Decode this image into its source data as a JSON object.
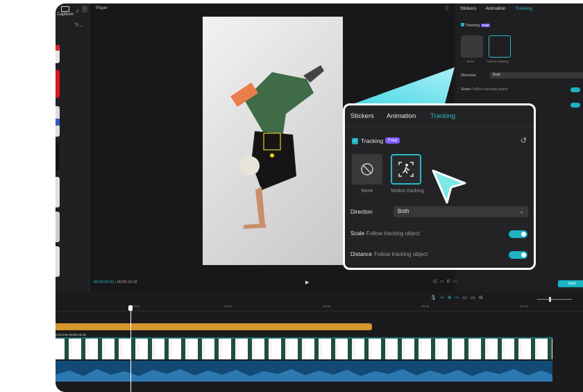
{
  "left_panel": {
    "captions_tab": "Captions",
    "second_tab": "F",
    "text_tool": "Tr"
  },
  "player": {
    "title": "Player",
    "current_time": "00:00:02:03",
    "total_time": "00:00:10:18"
  },
  "right_panel": {
    "tabs": [
      "Stickers",
      "Animation",
      "Tracking"
    ],
    "tracking_label": "Tracking",
    "free_badge": "Free",
    "option_none": "None",
    "option_motion": "Motion tracking",
    "direction_label": "Direction",
    "direction_value": "Both",
    "scale_label": "Scale",
    "scale_sub": "Follow tracking object",
    "start_button": "Start"
  },
  "popup": {
    "tabs": [
      "Stickers",
      "Animation",
      "Tracking"
    ],
    "tracking_label": "Tracking",
    "free_badge": "Free",
    "option_none": "None",
    "option_motion": "Motion tracking",
    "direction_label": "Direction",
    "direction_value": "Both",
    "scale_label": "Scale",
    "scale_sub": "Follow tracking object",
    "distance_label": "Distance",
    "distance_sub": "Follow tracking object"
  },
  "timeline": {
    "ruler": [
      "00:02",
      "00:04",
      "00:06",
      "00:08",
      "00:10"
    ],
    "clip_label": "0:10.mov  00:00:10:18"
  },
  "colors": {
    "accent": "#2ab8c8",
    "badge": "#7b5cff",
    "orange_track": "#d6962c",
    "audio_track": "#124a75"
  }
}
